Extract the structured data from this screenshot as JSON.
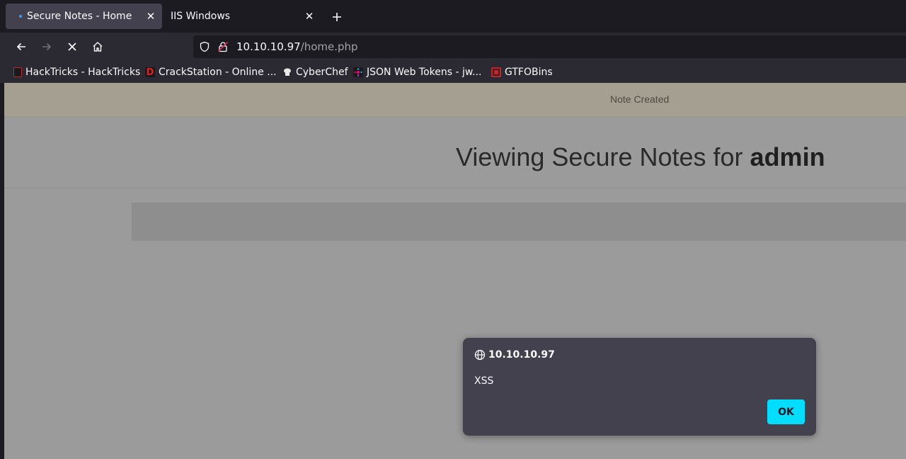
{
  "tabs": [
    {
      "label": "Secure Notes - Home",
      "close": "✕"
    },
    {
      "label": "IIS Windows",
      "close": "✕"
    }
  ],
  "toolbar": {
    "url_host": "10.10.10.97",
    "url_path": "/home.php"
  },
  "bookmarks": [
    {
      "label": "HackTricks - HackTricks",
      "icon": "hacktricks-icon",
      "color": "#c0262c"
    },
    {
      "label": "CrackStation - Online ...",
      "icon": "crackstation-icon",
      "glyph": "D",
      "color": "#e02020"
    },
    {
      "label": "CyberChef",
      "icon": "cyberchef-icon",
      "color": "#e0e0e0"
    },
    {
      "label": "JSON Web Tokens - jw...",
      "icon": "jwt-icon",
      "color": "#7b3ff2"
    },
    {
      "label": "GTFOBins",
      "icon": "gtfobins-icon",
      "color": "#c0262c"
    }
  ],
  "page": {
    "alert_text": "Note Created",
    "heading_prefix": "Viewing Secure Notes for ",
    "heading_user": "admin"
  },
  "dialog": {
    "origin": "10.10.10.97",
    "message": "XSS",
    "ok_label": "OK"
  },
  "colors": {
    "accent": "#00ddff",
    "tab_dot": "#3c9af2"
  }
}
